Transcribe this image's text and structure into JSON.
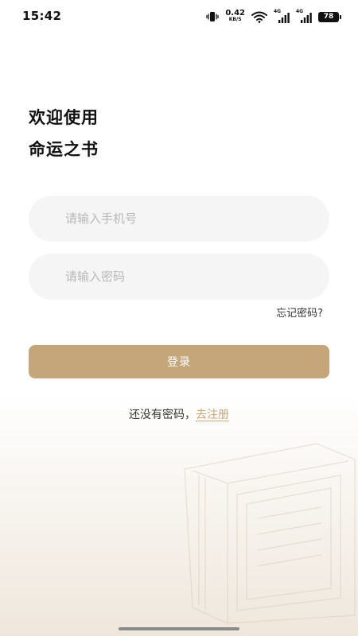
{
  "status_bar": {
    "time": "15:42",
    "net_speed_value": "0.42",
    "net_speed_unit": "KB/S",
    "signal1_label": "4G",
    "signal2_label": "4G",
    "battery_level": "78",
    "icons": [
      "vibrate-icon",
      "wifi-icon",
      "signal-icon",
      "battery-icon"
    ]
  },
  "header": {
    "line1": "欢迎使用",
    "line2": "命运之书"
  },
  "form": {
    "phone_placeholder": "请输入手机号",
    "phone_value": "",
    "password_placeholder": "请输入密码",
    "password_value": "",
    "forgot_label": "忘记密码?",
    "login_label": "登录"
  },
  "register": {
    "prompt": "还没有密码，",
    "link_label": "去注册"
  },
  "colors": {
    "accent": "#c4a67a",
    "field_bg": "#f5f5f5",
    "placeholder": "#b8b8b8"
  }
}
